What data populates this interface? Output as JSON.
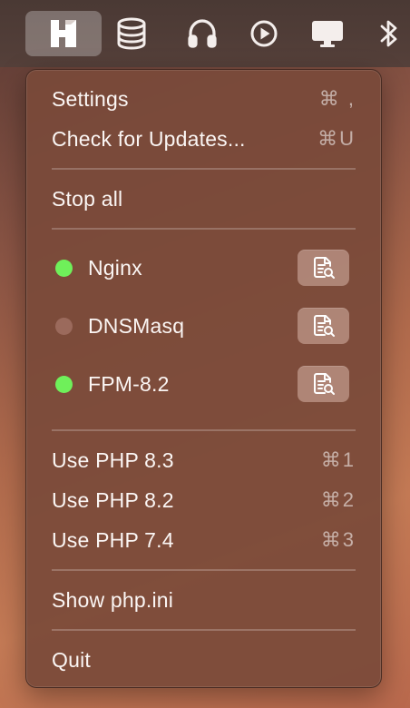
{
  "menubar": {
    "icons": [
      {
        "name": "herd-app-icon",
        "active": true
      },
      {
        "name": "database-icon"
      },
      {
        "name": "headphones-icon"
      },
      {
        "name": "play-icon"
      },
      {
        "name": "display-icon"
      },
      {
        "name": "bluetooth-icon"
      }
    ]
  },
  "menu": {
    "settings": {
      "label": "Settings",
      "shortcut": "⌘ ,"
    },
    "check_updates": {
      "label": "Check for Updates...",
      "shortcut": "⌘U"
    },
    "stop_all": {
      "label": "Stop all"
    },
    "services": [
      {
        "name": "Nginx",
        "status": "running",
        "status_color": "#6ff05a"
      },
      {
        "name": "DNSMasq",
        "status": "stopped",
        "status_color": "#9b6a5c"
      },
      {
        "name": "FPM-8.2",
        "status": "running",
        "status_color": "#6ff05a"
      }
    ],
    "service_log_icon": "log-search-icon",
    "php_versions": [
      {
        "label": "Use PHP 8.3",
        "shortcut": "⌘1"
      },
      {
        "label": "Use PHP 8.2",
        "shortcut": "⌘2"
      },
      {
        "label": "Use PHP 7.4",
        "shortcut": "⌘3"
      }
    ],
    "show_php_ini": {
      "label": "Show php.ini"
    },
    "quit": {
      "label": "Quit"
    }
  }
}
